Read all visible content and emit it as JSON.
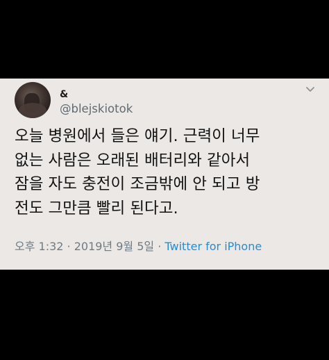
{
  "tweet": {
    "display_name": "&",
    "handle": "@blejskiotok",
    "text_lines": [
      "오늘 병원에서 들은 얘기. 근력이 너무",
      "없는 사람은 오래된 배터리와 같아서",
      "잠을 자도 충전이 조금밖에 안 되고 방",
      "전도 그만큼 빨리 된다고."
    ],
    "timestamp": "오후 1:32 · 2019년 9월 5일",
    "separator": " · ",
    "source": "Twitter for iPhone"
  },
  "icons": {
    "avatar": "profile-photo",
    "menu": "chevron-down-icon"
  }
}
